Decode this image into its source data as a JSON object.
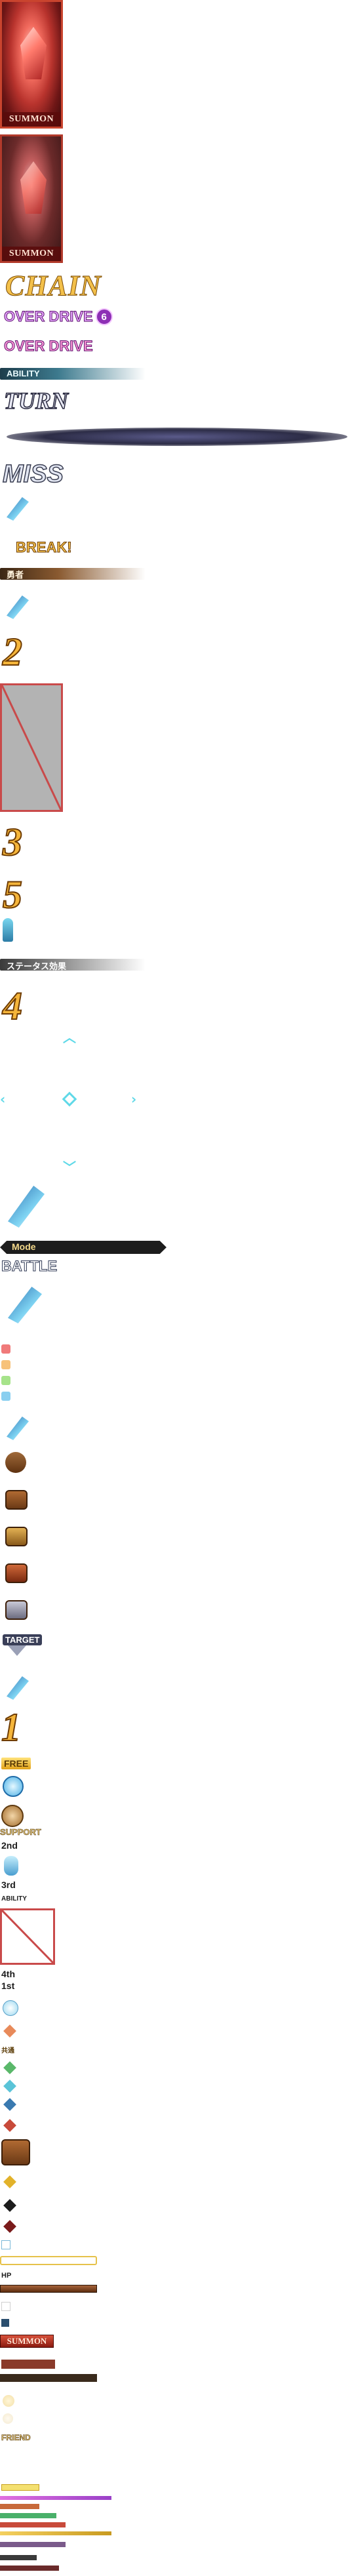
{
  "assets": {
    "summon_label": "SUMMON",
    "chain": "CHAIN",
    "overdrive_1": "OVER DRIVE",
    "overdrive_badge": "6",
    "overdrive_2": "OVER DRIVE",
    "ability": "ABILITY",
    "turn": "TURN",
    "miss": "MISS",
    "break": "BREAK!",
    "bar_label_1": "勇者",
    "num_2": "2",
    "num_3": "3",
    "num_5": "5",
    "status_effect": "ステータス効果",
    "num_4": "4",
    "mode": "Mode",
    "battle": "BATTLE",
    "target": "TARGET",
    "num_1": "1",
    "free": "FREE",
    "support": "SUPPORT",
    "second": "2nd",
    "third": "3rd",
    "ability_small": "ABILITY",
    "fourth": "4th",
    "first": "1st",
    "small_label": "共通",
    "hp": "HP",
    "summon_label_2": "SUMMON",
    "friend": "FRIEND"
  }
}
